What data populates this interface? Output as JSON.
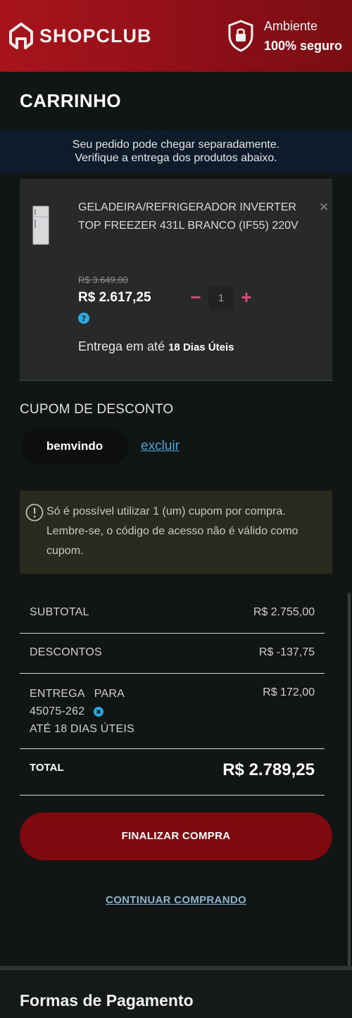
{
  "header": {
    "brand": "SHOPCLUB",
    "secure_line1": "Ambiente",
    "secure_line2": "100% seguro"
  },
  "page": {
    "title": "CARRINHO",
    "notice_line1": "Seu pedido pode chegar separadamente.",
    "notice_line2": "Verifique a entrega dos produtos abaixo."
  },
  "product": {
    "name": "GELADEIRA/REFRIGERADOR INVERTER TOP FREEZER 431L BRANCO (IF55) 220V",
    "old_price": "R$ 3.649,00",
    "price": "R$ 2.617,25",
    "quantity": "1",
    "minus": "−",
    "plus": "+",
    "remove": "×",
    "delivery_prefix": "Entrega em até",
    "delivery_days": "18 Dias Úteis"
  },
  "coupon": {
    "title": "CUPOM DE DESCONTO",
    "code": "bemvindo",
    "remove_label": "excluir",
    "warning": "Só é possível utilizar 1 (um) cupom por compra. Lembre-se, o código de acesso não é válido como cupom."
  },
  "summary": {
    "subtotal_label": "SUBTOTAL",
    "subtotal_value": "R$ 2.755,00",
    "discount_label": "DESCONTOS",
    "discount_value": "R$ -137,75",
    "shipping_line1": "ENTREGA   PARA",
    "shipping_cep": "45075-262",
    "shipping_line3": "ATÉ 18 DIAS ÚTEIS",
    "shipping_value": "R$ 172,00",
    "total_label": "TOTAL",
    "total_value": "R$ 2.789,25"
  },
  "actions": {
    "checkout": "FINALIZAR COMPRA",
    "continue": "CONTINUAR COMPRANDO"
  },
  "payment": {
    "title": "Formas de Pagamento"
  },
  "colors": {
    "brand_red": "#a8141c",
    "checkout_red": "#7e0a10",
    "link_blue": "#4da6d8",
    "qty_pink": "#e0487a"
  },
  "icons": {
    "logo": "shopclub-logo-icon",
    "secure": "shield-lock-icon",
    "help": "help-circle-icon",
    "warning": "exclamation-circle-icon",
    "remove_cep": "close-circle-icon"
  }
}
